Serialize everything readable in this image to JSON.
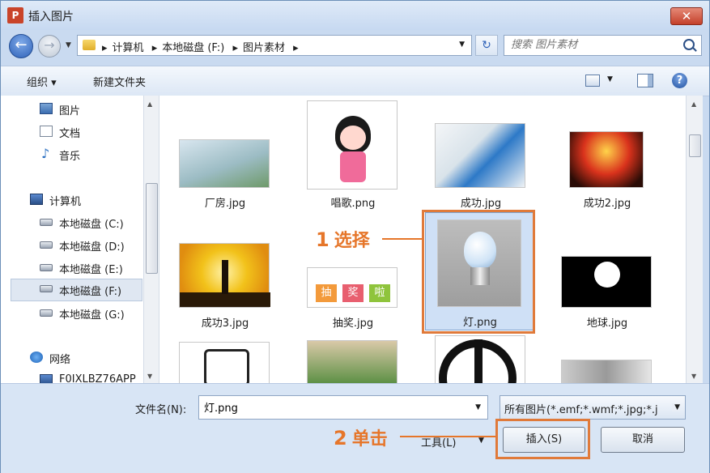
{
  "window": {
    "title": "插入图片",
    "app_icon": "P",
    "close_label": "✕"
  },
  "nav": {
    "breadcrumbs": [
      "计算机",
      "本地磁盘 (F:)",
      "图片素材"
    ],
    "search_placeholder": "搜索 图片素材"
  },
  "toolbar": {
    "organize_label": "组织 ▾",
    "new_folder_label": "新建文件夹",
    "help_label": "?"
  },
  "sidebar": {
    "items": [
      {
        "label": "图片",
        "icon": "picture-icon"
      },
      {
        "label": "文档",
        "icon": "document-icon"
      },
      {
        "label": "音乐",
        "icon": "music-icon"
      },
      {
        "label": "计算机",
        "icon": "computer-icon"
      },
      {
        "label": "本地磁盘 (C:)",
        "icon": "drive-icon"
      },
      {
        "label": "本地磁盘 (D:)",
        "icon": "drive-icon"
      },
      {
        "label": "本地磁盘 (E:)",
        "icon": "drive-icon"
      },
      {
        "label": "本地磁盘 (F:)",
        "icon": "drive-icon",
        "selected": true
      },
      {
        "label": "本地磁盘 (G:)",
        "icon": "drive-icon"
      },
      {
        "label": "网络",
        "icon": "network-icon"
      },
      {
        "label": "F0IXLBZ76APP",
        "icon": "computer-icon"
      }
    ]
  },
  "files": [
    {
      "name": "厂房.jpg"
    },
    {
      "name": "唱歌.png"
    },
    {
      "name": "成功.jpg"
    },
    {
      "name": "成功2.jpg"
    },
    {
      "name": "成功3.jpg"
    },
    {
      "name": "抽奖.jpg",
      "thumb_text": [
        "抽",
        "奖",
        "啦"
      ]
    },
    {
      "name": "灯.png",
      "selected": true
    },
    {
      "name": "地球.jpg"
    }
  ],
  "bottom": {
    "filename_label": "文件名(N):",
    "filename_value": "灯.png",
    "filetype_value": "所有图片(*.emf;*.wmf;*.jpg;*.j",
    "tools_label": "工具(L)",
    "insert_label": "插入(S)",
    "cancel_label": "取消"
  },
  "annotations": [
    {
      "num": "1",
      "text": "选择"
    },
    {
      "num": "2",
      "text": "单击"
    }
  ],
  "colors": {
    "annotation": "#e6762a",
    "selection": "#cfe0f6"
  }
}
